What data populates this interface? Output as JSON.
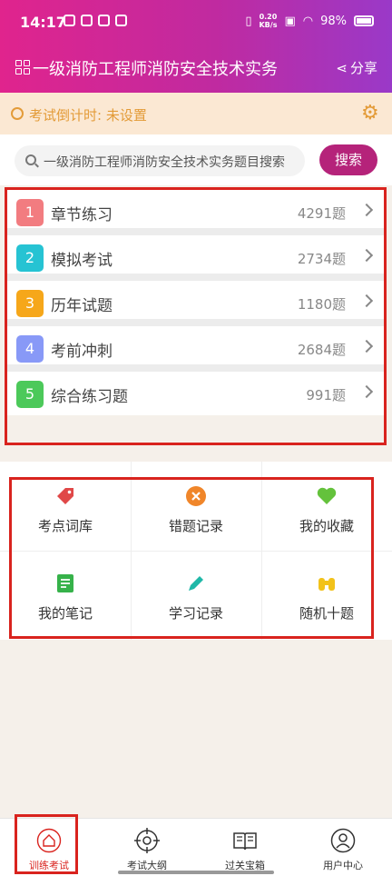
{
  "status_bar": {
    "time": "14:17",
    "speed_top": "0.20",
    "speed_unit": "KB/s",
    "battery": "98%"
  },
  "header": {
    "title": "一级消防工程师消防安全技术实务",
    "share_label": "分享"
  },
  "countdown": {
    "text": "考试倒计时: 未设置"
  },
  "search": {
    "placeholder": "一级消防工程师消防安全技术实务题目搜索",
    "button_label": "搜索"
  },
  "practice_list": [
    {
      "num": "1",
      "label": "章节练习",
      "count": "4291题",
      "color": "#f27c80"
    },
    {
      "num": "2",
      "label": "模拟考试",
      "count": "2734题",
      "color": "#26c3d3"
    },
    {
      "num": "3",
      "label": "历年试题",
      "count": "1180题",
      "color": "#f6a71a"
    },
    {
      "num": "4",
      "label": "考前冲刺",
      "count": "2684题",
      "color": "#8899f7"
    },
    {
      "num": "5",
      "label": "综合练习题",
      "count": "991题",
      "color": "#4cc95a"
    }
  ],
  "tools": [
    {
      "label": "考点词库",
      "icon": "tag-icon",
      "color": "#e04848"
    },
    {
      "label": "错题记录",
      "icon": "close-circle-icon",
      "color": "#f0862a"
    },
    {
      "label": "我的收藏",
      "icon": "heart-icon",
      "color": "#64c23c"
    },
    {
      "label": "我的笔记",
      "icon": "notebook-icon",
      "color": "#36b24a"
    },
    {
      "label": "学习记录",
      "icon": "pencil-icon",
      "color": "#1fb8a8"
    },
    {
      "label": "随机十题",
      "icon": "binoculars-icon",
      "color": "#f2c21a"
    }
  ],
  "tabs": [
    {
      "label": "训练考试",
      "icon": "home-icon",
      "active": true
    },
    {
      "label": "考试大纲",
      "icon": "target-icon",
      "active": false
    },
    {
      "label": "过关宝箱",
      "icon": "book-icon",
      "active": false
    },
    {
      "label": "用户中心",
      "icon": "user-icon",
      "active": false
    }
  ]
}
